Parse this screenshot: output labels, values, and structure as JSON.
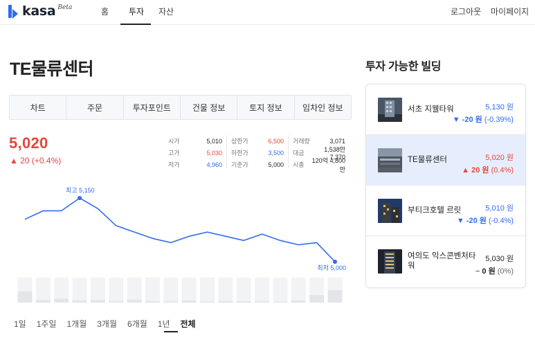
{
  "nav": {
    "logo_text": "kasa",
    "logo_badge": "Beta",
    "items": [
      "홈",
      "투자",
      "자산"
    ],
    "right": [
      "로그아웃",
      "마이페이지"
    ]
  },
  "building": {
    "title": "TE물류센터",
    "tabs": [
      "차트",
      "주문",
      "투자포인트",
      "건물 정보",
      "토지 정보",
      "임차인 정보"
    ],
    "price": "5,020",
    "change": "▲ 20 (+0.4%)"
  },
  "stats": {
    "col1": [
      {
        "label": "시가",
        "value": "5,010"
      },
      {
        "label": "고가",
        "value": "5,030"
      },
      {
        "label": "저가",
        "value": "4,960"
      }
    ],
    "col2": [
      {
        "label": "상한가",
        "value": "6,500"
      },
      {
        "label": "하한가",
        "value": "3,500"
      },
      {
        "label": "기준가",
        "value": "5,000"
      }
    ],
    "col3": [
      {
        "label": "거래량",
        "value": "3,071"
      },
      {
        "label": "대금",
        "value": "1,538만 7,370"
      },
      {
        "label": "시총",
        "value": "120억 4,800만"
      }
    ]
  },
  "chart_data": {
    "type": "line",
    "series": [
      {
        "values": [
          5100,
          5120,
          5120,
          5150,
          5125,
          5085,
          5070,
          5055,
          5045,
          5060,
          5070,
          5060,
          5050,
          5065,
          5050,
          5040,
          5045,
          5000
        ]
      }
    ],
    "volume": [
      0.45,
      0.1,
      0.15,
      0.08,
      0.1,
      0.05,
      0.12,
      0.06,
      0.05,
      0.08,
      0.04,
      0.07,
      0.06,
      0.05,
      0.04,
      0.08,
      0.3,
      0.5
    ],
    "high_label": "최고 5,150",
    "low_label": "최저 5,000",
    "color": "#2f6bf1"
  },
  "periods": [
    "1일",
    "1주일",
    "1개월",
    "3개월",
    "6개월",
    "1년",
    "전체"
  ],
  "sidebar": {
    "title": "투자 가능한 빌딩",
    "buildings": [
      {
        "name": "서초 지웰타워",
        "price": "5,130 원",
        "change_arrow": "▼",
        "change_value": "-20 원",
        "change_pct": "(-0.39%)",
        "tone": "blue"
      },
      {
        "name": "TE물류센터",
        "price": "5,020 원",
        "change_arrow": "▲",
        "change_value": "20 원",
        "change_pct": "(0.4%)",
        "tone": "red"
      },
      {
        "name": "부티크호텔 르릿",
        "price": "5,010 원",
        "change_arrow": "▼",
        "change_value": "-20 원",
        "change_pct": "(-0.4%)",
        "tone": "blue"
      },
      {
        "name": "여의도 익스콘벤처타워",
        "price": "5,030 원",
        "change_arrow": "−",
        "change_value": "0 원",
        "change_pct": "(0%)",
        "tone": "grey"
      }
    ]
  },
  "colors": {
    "accent": "#2f6bf1",
    "up": "#e8453c",
    "down": "#2f6bf1",
    "selected_bg": "#e6eefd"
  }
}
